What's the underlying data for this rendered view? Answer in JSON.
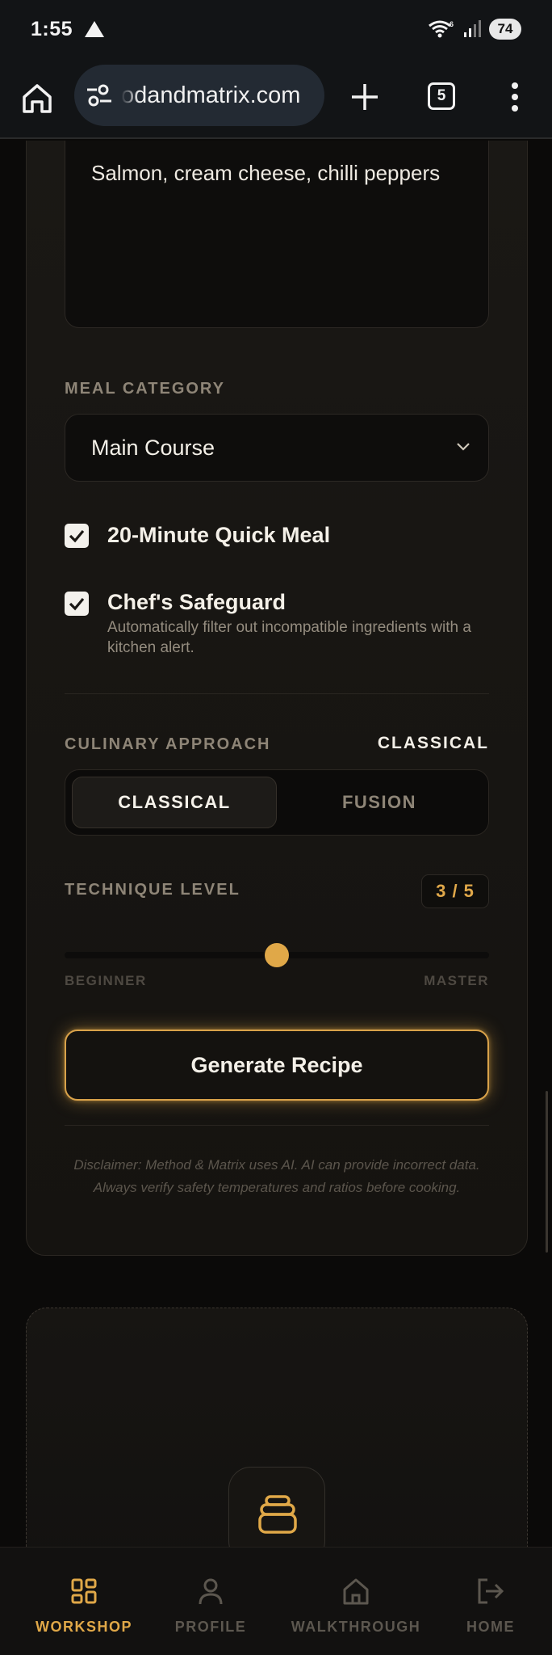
{
  "status_bar": {
    "time": "1:55",
    "battery": "74",
    "wifi_badge": "6"
  },
  "browser": {
    "url": "odandmatrix.com",
    "tab_count": "5"
  },
  "form": {
    "ingredients_value": "Salmon, cream cheese, chilli peppers",
    "meal_category_label": "MEAL CATEGORY",
    "meal_category_value": "Main Course",
    "quick_meal": {
      "label": "20-Minute Quick Meal",
      "checked": true
    },
    "safeguard": {
      "label": "Chef's Safeguard",
      "description": "Automatically filter out incompatible ingredients with a kitchen alert.",
      "checked": true
    },
    "culinary_approach_label": "CULINARY APPROACH",
    "culinary_approach_value": "CLASSICAL",
    "approach_options": [
      "CLASSICAL",
      "FUSION"
    ],
    "selected_approach": "CLASSICAL",
    "technique_level_label": "TECHNIQUE LEVEL",
    "technique_level_display": "3 / 5",
    "technique_level_value": 3,
    "technique_level_max": 5,
    "slider_min_label": "BEGINNER",
    "slider_max_label": "MASTER",
    "generate_button": "Generate Recipe",
    "disclaimer": "Disclaimer: Method & Matrix uses AI. AI can provide incorrect data. Always verify safety temperatures and ratios before cooking."
  },
  "bottom_nav": {
    "items": [
      {
        "label": "WORKSHOP",
        "icon": "grid-icon",
        "active": true
      },
      {
        "label": "PROFILE",
        "icon": "user-icon",
        "active": false
      },
      {
        "label": "WALKTHROUGH",
        "icon": "home-icon",
        "active": false
      },
      {
        "label": "HOME",
        "icon": "logout-icon",
        "active": false
      }
    ]
  },
  "colors": {
    "accent": "#e0a848",
    "background": "#0b0a09",
    "card": "#1a1815",
    "muted_text": "#8e8577"
  }
}
